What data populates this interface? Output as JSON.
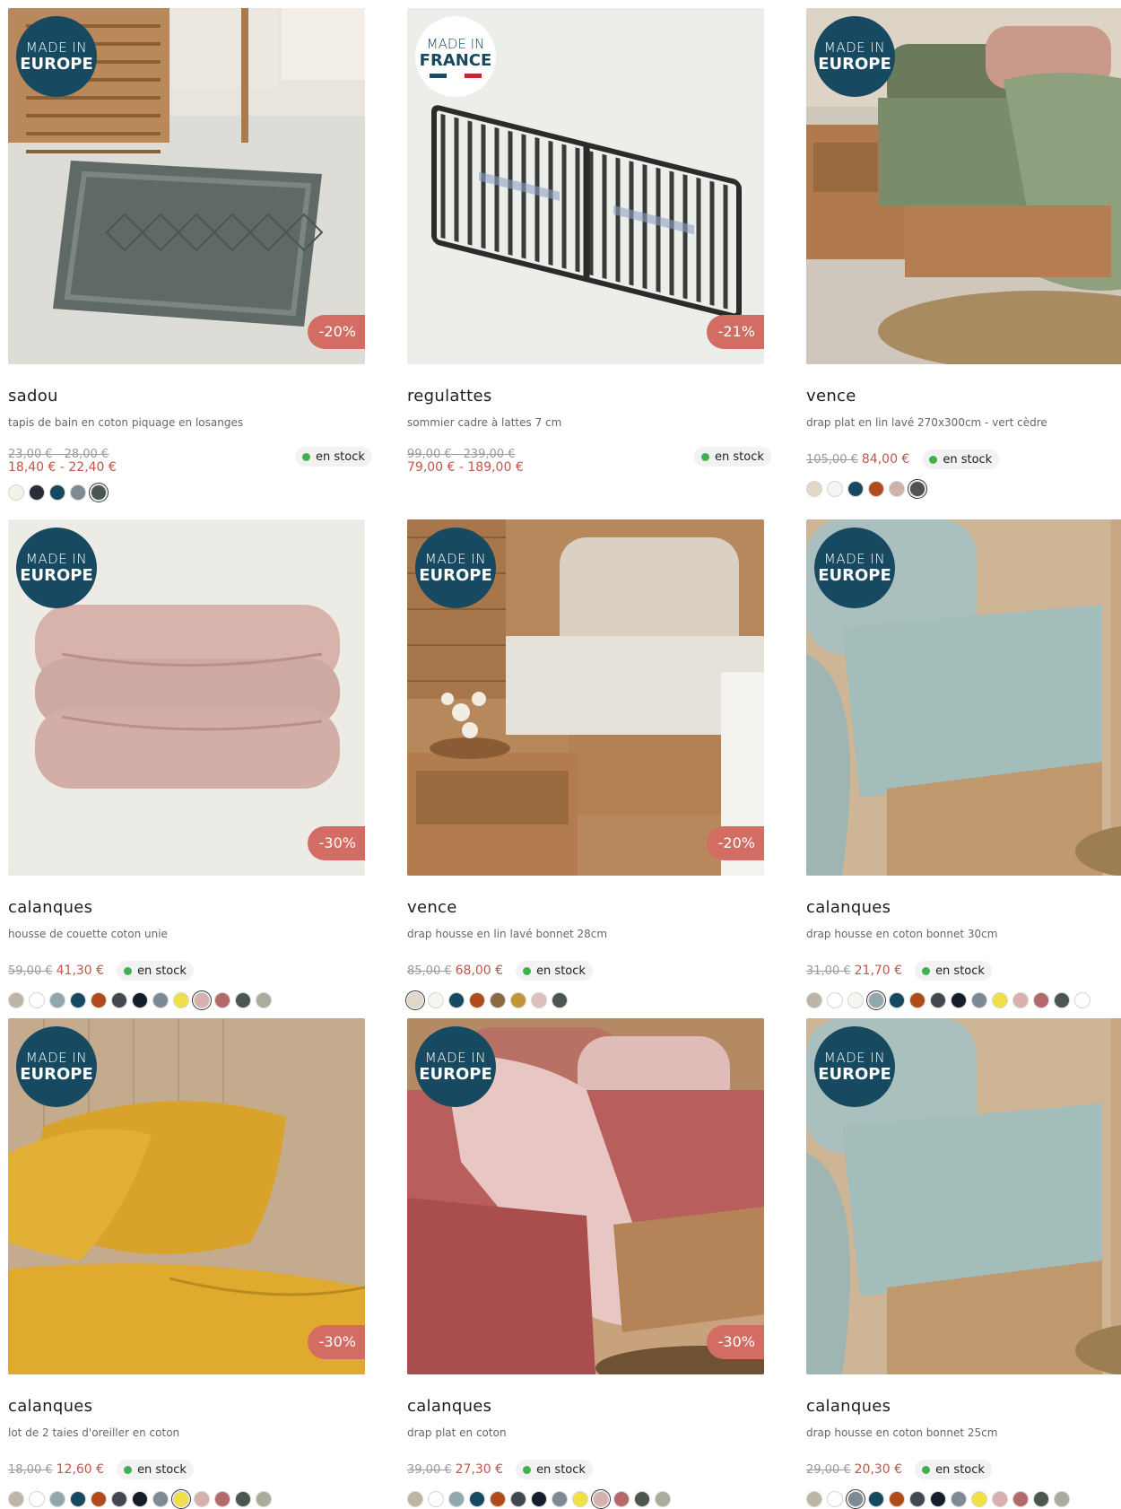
{
  "products": [
    {
      "id": "sadou-tapis",
      "name": "sadou",
      "desc": "tapis de bain en coton piquage en losanges",
      "badge": "europe",
      "discount": "-20%",
      "old_price": "23,00 € - 28,00 €",
      "new_price": "18,40 € - 22,40 €",
      "price_layout": "stacked",
      "stock": "en stock",
      "swatches": [
        "#f4f1e6",
        "#2b2d36",
        "#174a60",
        "#7e8a93",
        "#4b564e"
      ],
      "selected_swatch": 4,
      "image": "rug"
    },
    {
      "id": "regulattes",
      "name": "regulattes",
      "desc": "sommier cadre à lattes 7 cm",
      "badge": "france",
      "discount": "-21%",
      "old_price": "99,00 € - 239,00 €",
      "new_price": "79,00 € - 189,00 €",
      "price_layout": "stacked",
      "stock": "en stock",
      "swatches": [],
      "selected_swatch": -1,
      "image": "slats"
    },
    {
      "id": "vence-drap-plat",
      "name": "vence",
      "desc": "drap plat en lin lavé 270x300cm - vert cèdre",
      "badge": "europe",
      "discount": "",
      "old_price": "105,00 €",
      "new_price": "84,00 €",
      "price_layout": "inline",
      "stock": "en stock",
      "swatches": [
        "#e3d8c8",
        "#f6f5f1",
        "#174a60",
        "#b04c1b",
        "#cfb1a8",
        "#4b564e"
      ],
      "selected_swatch": 5,
      "image": "bed-green"
    },
    {
      "id": "calanques-housse-couette",
      "name": "calanques",
      "desc": "housse de couette coton unie",
      "badge": "europe",
      "discount": "-30%",
      "old_price": "59,00 €",
      "new_price": "41,30 €",
      "price_layout": "inline",
      "stock": "en stock",
      "swatches": [
        "#bdb5a6",
        "#ffffff",
        "#8fa7ad",
        "#174a60",
        "#b04c1b",
        "#43474f",
        "#151d2b",
        "#7e8a93",
        "#f1e045",
        "#d6b1ad",
        "#b5686a",
        "#4b564e",
        "#a9ad9b"
      ],
      "selected_swatch": 9,
      "image": "duvet-pink"
    },
    {
      "id": "vence-drap-housse",
      "name": "vence",
      "desc": "drap housse en lin lavé bonnet 28cm",
      "badge": "europe",
      "discount": "-20%",
      "old_price": "85,00 €",
      "new_price": "68,00 €",
      "price_layout": "inline",
      "stock": "en stock",
      "swatches": [
        "#e3d8c8",
        "#f6f5f1",
        "#174a60",
        "#b04c1b",
        "#8a6a45",
        "#c29637",
        "#dcc0bd",
        "#4b564e"
      ],
      "selected_swatch": 0,
      "image": "bed-beige"
    },
    {
      "id": "calanques-drap-housse-30",
      "name": "calanques",
      "desc": "drap housse en coton bonnet 30cm",
      "badge": "europe",
      "discount": "",
      "old_price": "31,00 €",
      "new_price": "21,70 €",
      "price_layout": "inline",
      "stock": "en stock",
      "swatches": [
        "#bdb5a6",
        "#ffffff",
        "#f6f5f1",
        "#8fa7ad",
        "#174a60",
        "#b04c1b",
        "#43474f",
        "#151d2b",
        "#7e8a93",
        "#f1e045",
        "#d6b1ad",
        "#b5686a",
        "#4b564e",
        "#ffffff"
      ],
      "selected_swatch": 3,
      "image": "bed-blue"
    },
    {
      "id": "calanques-taies",
      "name": "calanques",
      "desc": "lot de 2 taies d'oreiller en coton",
      "badge": "europe",
      "discount": "-30%",
      "old_price": "18,00 €",
      "new_price": "12,60 €",
      "price_layout": "inline",
      "stock": "en stock",
      "swatches": [
        "#bdb5a6",
        "#ffffff",
        "#8fa7ad",
        "#174a60",
        "#b04c1b",
        "#43474f",
        "#151d2b",
        "#7e8a93",
        "#f1e045",
        "#d6b1ad",
        "#b5686a",
        "#4b564e",
        "#a9ad9b"
      ],
      "selected_swatch": 8,
      "image": "pillows-yellow"
    },
    {
      "id": "calanques-drap-plat",
      "name": "calanques",
      "desc": "drap plat en coton",
      "badge": "europe",
      "discount": "-30%",
      "old_price": "39,00 €",
      "new_price": "27,30 €",
      "price_layout": "inline",
      "stock": "en stock",
      "swatches": [
        "#bdb5a6",
        "#ffffff",
        "#8fa7ad",
        "#174a60",
        "#b04c1b",
        "#43474f",
        "#151d2b",
        "#7e8a93",
        "#f1e045",
        "#d6b1ad",
        "#b5686a",
        "#4b564e",
        "#a9ad9b"
      ],
      "selected_swatch": 9,
      "image": "bed-rose"
    },
    {
      "id": "calanques-drap-housse-25",
      "name": "calanques",
      "desc": "drap housse en coton bonnet 25cm",
      "badge": "europe",
      "discount": "",
      "old_price": "29,00 €",
      "new_price": "20,30 €",
      "price_layout": "inline",
      "stock": "en stock",
      "swatches": [
        "#bdb5a6",
        "#ffffff",
        "#7e8a93",
        "#174a60",
        "#b04c1b",
        "#43474f",
        "#151d2b",
        "#7e8a93",
        "#f1e045",
        "#d6b1ad",
        "#b5686a",
        "#4b564e",
        "#a9ad9b"
      ],
      "selected_swatch": 2,
      "image": "bed-blue"
    }
  ],
  "badges": {
    "europe": {
      "line1": "MADE IN",
      "line2": "EUROPE"
    },
    "france": {
      "line1": "MADE IN",
      "line2": "FRANCE",
      "flag": [
        "#174a60",
        "#ffffff",
        "#c8262f"
      ]
    }
  }
}
